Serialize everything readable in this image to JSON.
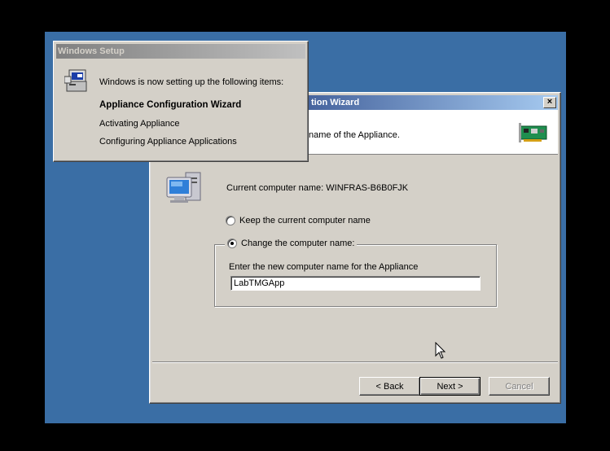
{
  "wizard": {
    "title": "tion Wizard",
    "close_label": "×",
    "header_subtitle": "name of the Appliance.",
    "current_name_label": "Current computer name: WINFRAS-B6B0FJK",
    "keep_option": "Keep the current computer name",
    "change_option": "Change the computer name:",
    "enter_label": "Enter the new computer name for the Appliance",
    "new_name_value": "LabTMGApp",
    "back_button": "< Back",
    "next_button": "Next >",
    "cancel_button": "Cancel"
  },
  "setup": {
    "title": "Windows Setup",
    "intro": "Windows is now setting up the following items:",
    "items": [
      {
        "label": "Appliance Configuration Wizard",
        "active": true
      },
      {
        "label": "Activating Appliance",
        "active": false
      },
      {
        "label": "Configuring Appliance Applications",
        "active": false
      }
    ]
  },
  "colors": {
    "desktop": "#3a6ea5",
    "title_active": "#0a246a",
    "title_inactive": "#808080",
    "face": "#d4d0c8"
  }
}
